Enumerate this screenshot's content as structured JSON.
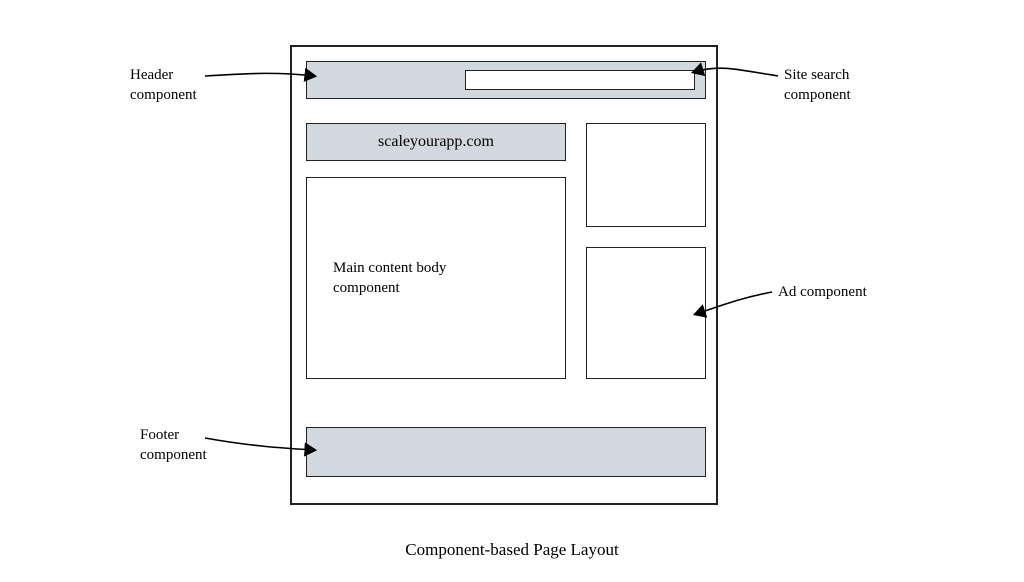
{
  "annotations": {
    "header": "Header\ncomponent",
    "search": "Site search\ncomponent",
    "ad": "Ad component",
    "footer": "Footer\ncomponent"
  },
  "site_title": "scaleyourapp.com",
  "main_content_text": "Main content body\ncomponent",
  "caption": "Component-based Page Layout"
}
